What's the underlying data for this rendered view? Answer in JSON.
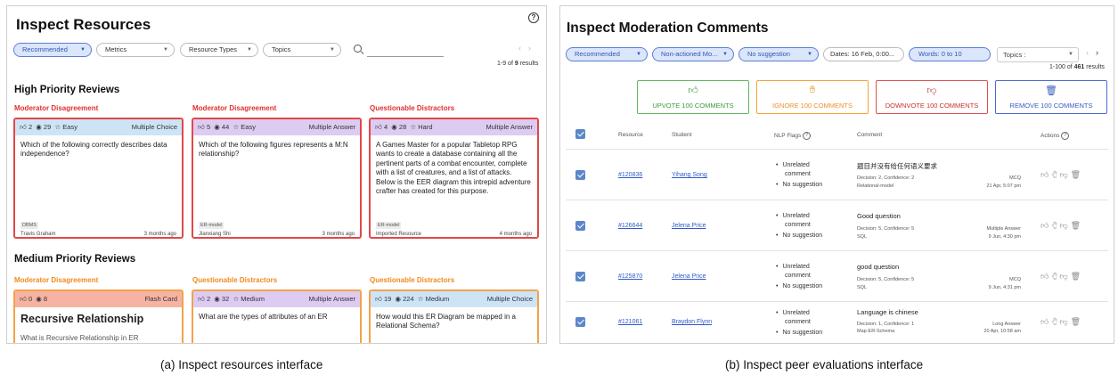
{
  "left": {
    "title": "Inspect Resources",
    "filters": {
      "recommended": "Recommended",
      "metrics": "Metrics",
      "resource_types": "Resource Types",
      "topics": "Topics"
    },
    "pager": {
      "prefix": "1-9 of ",
      "total": "9",
      "suffix": " results"
    },
    "sections": [
      {
        "title": "High Priority Reviews",
        "cards": [
          {
            "category": "Moderator Disagreement",
            "cat_color": "red",
            "likes": "2",
            "views": "29",
            "difficulty": "Easy",
            "qtype": "Multiple Choice",
            "head_color": "blue",
            "text": "Which of the following correctly describes data independence?",
            "tag": "DBMS",
            "author": "Travis Graham",
            "ago": "3 months ago"
          },
          {
            "category": "Moderator Disagreement",
            "cat_color": "red",
            "likes": "5",
            "views": "44",
            "difficulty": "Easy",
            "qtype": "Multiple Answer",
            "head_color": "purple",
            "text": "Which of the following figures represents a M:N relationship?",
            "tag": "ER-model",
            "author": "Jianxiang Shi",
            "ago": "3 months ago"
          },
          {
            "category": "Questionable Distractors",
            "cat_color": "red",
            "likes": "4",
            "views": "28",
            "difficulty": "Hard",
            "qtype": "Multiple Answer",
            "head_color": "purple",
            "text": "A Games Master for a popular Tabletop RPG wants to create a database containing all the pertinent parts of a combat encounter, complete with a list of creatures, and a list of attacks. Below is the EER diagram this intrepid adventure crafter has created for this purpose.",
            "tag": "ER-model",
            "author": "Imported Resource",
            "ago": "4 months ago"
          }
        ]
      },
      {
        "title": "Medium Priority Reviews",
        "cards": [
          {
            "category": "Moderator Disagreement",
            "cat_color": "orange",
            "likes": "0",
            "views": "8",
            "difficulty": "",
            "qtype": "Flash Card",
            "head_color": "salmon",
            "big": "Recursive Relationship",
            "sub": "What is Recursive Relationship in ER"
          },
          {
            "category": "Questionable Distractors",
            "cat_color": "orange",
            "likes": "2",
            "views": "32",
            "difficulty": "Medium",
            "qtype": "Multiple Answer",
            "head_color": "purple",
            "text": "What are the types of attributes of an ER"
          },
          {
            "category": "Questionable Distractors",
            "cat_color": "orange",
            "likes": "19",
            "views": "224",
            "difficulty": "Medium",
            "qtype": "Multiple Choice",
            "head_color": "blue",
            "text": "How would this ER Diagram be mapped in a Relational Schema?"
          }
        ]
      }
    ]
  },
  "right": {
    "title": "Inspect Moderation Comments",
    "filters": {
      "recommended": "Recommended",
      "non_actioned": "Non-actioned Mo...",
      "no_suggestion": "No suggestion",
      "dates": "Dates: 16 Feb, 0:00...",
      "words": "Words: 0 to 10",
      "topics": "Topics :"
    },
    "pager": {
      "prefix": "1-100 of ",
      "total": "461",
      "suffix": " results"
    },
    "bulk_actions": {
      "upvote": "UPVOTE 100 COMMENTS",
      "ignore": "IGNORE 100 COMMENTS",
      "downvote": "DOWNVOTE 100 COMMENTS",
      "remove": "REMOVE 100 COMMENTS"
    },
    "columns": {
      "resource": "Resource",
      "student": "Student",
      "nlp": "NLP Flags",
      "comment": "Comment",
      "actions": "Actions"
    },
    "rows": [
      {
        "resource": "#120836",
        "student": "Yihang Song",
        "flag1a": "Unrelated",
        "flag1b": "comment",
        "flag2": "No suggestion",
        "comment": "题目并没有给任何语义要求",
        "decision": "Decision: 2, Confidence: 2",
        "topic": "Relational-model",
        "qtype": "MCQ",
        "date": "21 Apr, 5:07 pm"
      },
      {
        "resource": "#126644",
        "student": "Jelena Price",
        "flag1a": "Unrelated",
        "flag1b": "comment",
        "flag2": "No suggestion",
        "comment": "Good question",
        "decision": "Decision: 5, Confidence: 5",
        "topic": "SQL",
        "qtype": "Multiple Answer",
        "date": "9 Jun, 4:30 pm"
      },
      {
        "resource": "#125870",
        "student": "Jelena Price",
        "flag1a": "Unrelated",
        "flag1b": "comment",
        "flag2": "No suggestion",
        "comment": "good question",
        "decision": "Decision: 5, Confidence: 5",
        "topic": "SQL",
        "qtype": "MCQ",
        "date": "9 Jun, 4:31 pm"
      },
      {
        "resource": "#121061",
        "student": "Braydon Flynn",
        "flag1a": "Unrelated",
        "flag1b": "comment",
        "flag2": "No suggestion",
        "comment": "Language is chinese",
        "decision": "Decision: 1, Confidence: 1",
        "topic": "Map-ER-Schema",
        "qtype": "Long Answer",
        "date": "20 Apr, 10:58 am"
      }
    ]
  },
  "captions": {
    "a": "(a) Inspect resources interface",
    "b": "(b) Inspect peer evaluations interface"
  }
}
